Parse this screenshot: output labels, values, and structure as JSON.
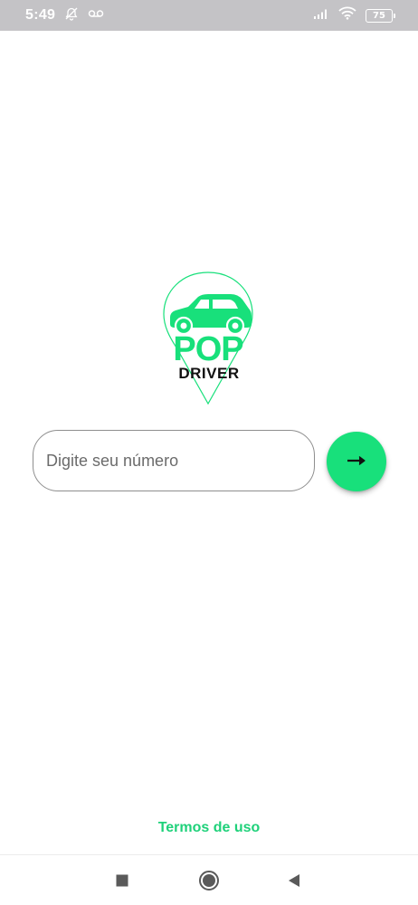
{
  "status_bar": {
    "time": "5:49",
    "battery_level": "75",
    "icons": [
      "alarm-off-icon",
      "voicemail-icon",
      "signal-icon",
      "wifi-icon",
      "battery-icon"
    ]
  },
  "logo": {
    "brand_primary": "POP",
    "brand_secondary": "DRIVER",
    "accent_color": "#18e07b"
  },
  "login": {
    "phone_placeholder": "Digite seu número",
    "phone_value": "",
    "next_icon": "arrow-right-icon"
  },
  "footer": {
    "terms_label": "Termos de uso"
  },
  "nav_bar": {
    "icons": [
      "recents-square-icon",
      "home-circle-icon",
      "back-triangle-icon"
    ]
  },
  "colors": {
    "accent": "#18e07b",
    "link": "#1fd17a",
    "status_bar_bg": "#c4c3c6"
  }
}
